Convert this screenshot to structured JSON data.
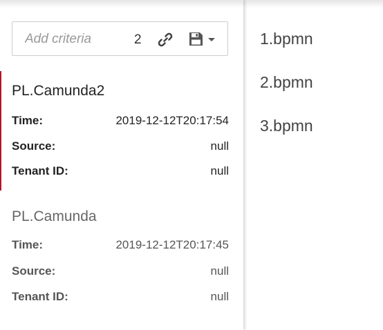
{
  "filter": {
    "placeholder": "Add criteria",
    "count": "2",
    "link_icon": "link-icon",
    "save_icon": "floppy-disk-icon",
    "caret_icon": "caret-down-icon"
  },
  "instances": [
    {
      "title": "PL.Camunda2",
      "fields": [
        {
          "label": "Time:",
          "value": "2019-12-12T20:17:54"
        },
        {
          "label": "Source:",
          "value": "null"
        },
        {
          "label": "Tenant ID:",
          "value": "null"
        }
      ]
    },
    {
      "title": "PL.Camunda",
      "fields": [
        {
          "label": "Time:",
          "value": "2019-12-12T20:17:45"
        },
        {
          "label": "Source:",
          "value": "null"
        },
        {
          "label": "Tenant ID:",
          "value": "null"
        }
      ]
    }
  ],
  "resources": [
    "1.bpmn",
    "2.bpmn",
    "3.bpmn"
  ],
  "colors": {
    "selection_accent": "#b5152b",
    "text": "#333333",
    "placeholder": "#999999"
  }
}
